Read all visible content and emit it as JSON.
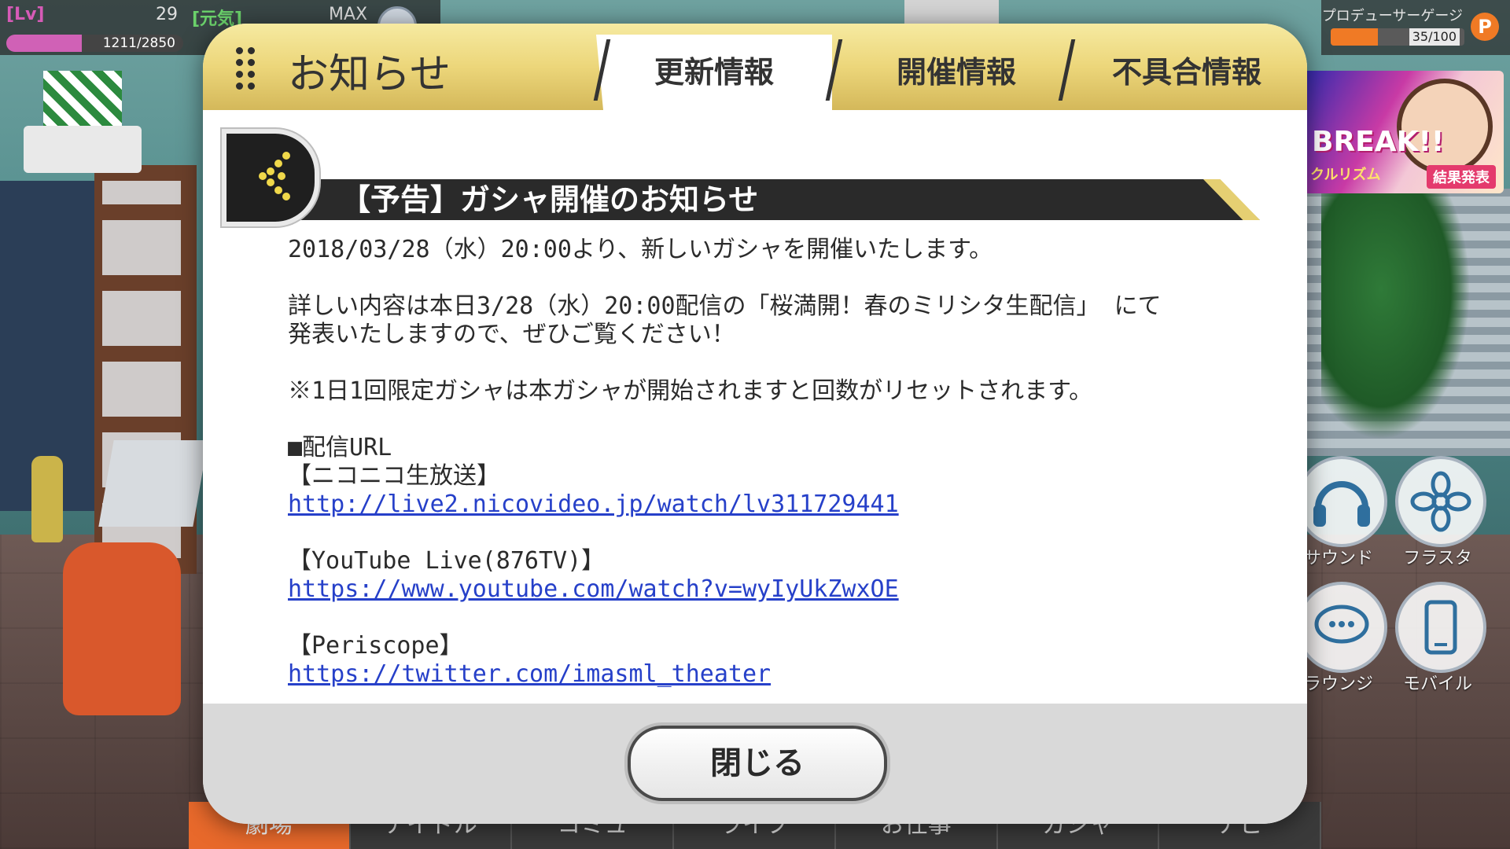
{
  "hud": {
    "lv_label": "[Lv]",
    "lv_value": "29",
    "genki_label": "[元気]",
    "max_label": "MAX",
    "exp_text": "1211/2850",
    "exp_fraction": 0.425,
    "gauge_label": "プロデューサーゲージ",
    "gauge_text": "35/100",
    "gauge_fraction": 0.35,
    "gauge_icon": "P"
  },
  "banner": {
    "title": "BREAK!!",
    "subtitle": "クルリズム",
    "result_badge": "結果発表"
  },
  "side_buttons": [
    {
      "label": "サウンド",
      "icon": "headphones-icon"
    },
    {
      "label": "フラスタ",
      "icon": "flower-icon"
    },
    {
      "label": "ラウンジ",
      "icon": "chat-bubbles-icon"
    },
    {
      "label": "モバイル",
      "icon": "phone-icon"
    }
  ],
  "bottom_nav": [
    "劇場",
    "アイドル",
    "コミュ",
    "ライブ",
    "お仕事",
    "ガシャ",
    "ナビ"
  ],
  "dialog": {
    "title": "お知らせ",
    "tabs": [
      "更新情報",
      "開催情報",
      "不具合情報"
    ],
    "active_tab": "更新情報",
    "notice_title": "【予告】ガシャ開催のお知らせ",
    "body": {
      "line1": "2018/03/28（水）20:00より、新しいガシャを開催いたします。",
      "line2a": "詳しい内容は本日3/28（水）20:00配信の「桜満開！春のミリシタ生配信」 にて",
      "line2b": "発表いたしますので、ぜひご覧ください！",
      "line3": "※1日1回限定ガシャは本ガシャが開始されますと回数がリセットされます。",
      "stream_header": "■配信URL",
      "niconico_label": "【ニコニコ生放送】",
      "niconico_url": "http://live2.nicovideo.jp/watch/lv311729441",
      "youtube_label": "【YouTube Live(876TV)】",
      "youtube_url": "https://www.youtube.com/watch?v=wyIyUkZwxOE",
      "periscope_label": "【Periscope】",
      "periscope_url": "https://twitter.com/imasml_theater"
    },
    "close_label": "閉じる"
  },
  "colors": {
    "header_gold": "#ecd67a",
    "link_blue": "#2640c9",
    "title_bar": "#2a2a2a",
    "accent_orange": "#e8692b"
  }
}
